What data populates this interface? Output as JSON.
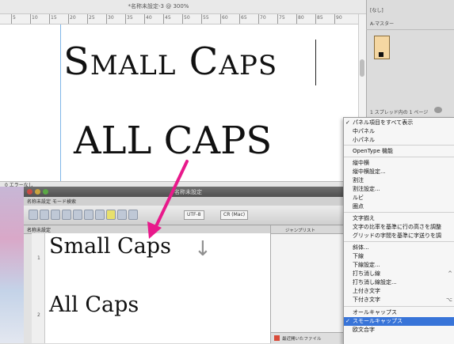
{
  "top_window": {
    "title": "*名称未設定-3 @ 300%",
    "ruler_numbers": [
      "5",
      "10",
      "15",
      "20",
      "25",
      "30",
      "35",
      "40",
      "45",
      "50",
      "55",
      "60",
      "65",
      "70",
      "75",
      "80",
      "85",
      "90"
    ],
    "small_caps_text": "Small Caps",
    "all_caps_text": "ALL CAPS",
    "status_text": "0 エラーなし"
  },
  "right_panel": {
    "title": "[なし]",
    "subtitle": "A-マスター",
    "status": "1 スプレッド内の 1 ページ"
  },
  "editor": {
    "title": "名称未設定",
    "menus": [
      "名称未設定",
      "モード",
      "検索"
    ],
    "toolbar_encoding": "UTF-8",
    "toolbar_lineend": "CR (Mac)",
    "tab_label": "名称未設定",
    "line_numbers": [
      "1",
      "2"
    ],
    "line1": "Small Caps",
    "down_arrow": "↓",
    "line2": "All Caps",
    "side_header": "ジャンプリスト",
    "recent_files": "最近開いたファイル"
  },
  "context_menu": {
    "items": [
      {
        "label": "パネル項目をすべて表示",
        "checked": true,
        "shortcut": ""
      },
      {
        "label": "中パネル",
        "checked": false,
        "shortcut": ""
      },
      {
        "label": "小パネル",
        "checked": false,
        "shortcut": ""
      },
      {
        "label": "OpenType 機能",
        "checked": false,
        "shortcut": ""
      },
      {
        "label": "縦中横",
        "checked": false,
        "shortcut": ""
      },
      {
        "label": "縦中横設定...",
        "checked": false,
        "shortcut": ""
      },
      {
        "label": "割注",
        "checked": false,
        "shortcut": ""
      },
      {
        "label": "割注設定...",
        "checked": false,
        "shortcut": ""
      },
      {
        "label": "ルビ",
        "checked": false,
        "shortcut": ""
      },
      {
        "label": "圏点",
        "checked": false,
        "shortcut": ""
      },
      {
        "label": "文字揃え",
        "checked": false,
        "shortcut": ""
      },
      {
        "label": "文字の比率を基準に行の高さを調整",
        "checked": false,
        "shortcut": ""
      },
      {
        "label": "グリッドの字間を基準に字送りを調",
        "checked": false,
        "shortcut": ""
      },
      {
        "label": "斜体...",
        "checked": false,
        "shortcut": ""
      },
      {
        "label": "下線",
        "checked": false,
        "shortcut": ""
      },
      {
        "label": "下線設定...",
        "checked": false,
        "shortcut": ""
      },
      {
        "label": "打ち消し線",
        "checked": false,
        "shortcut": "^"
      },
      {
        "label": "打ち消し線設定...",
        "checked": false,
        "shortcut": ""
      },
      {
        "label": "上付き文字",
        "checked": false,
        "shortcut": ""
      },
      {
        "label": "下付き文字",
        "checked": false,
        "shortcut": "⌥"
      },
      {
        "label": "オールキャップス",
        "checked": false,
        "shortcut": ""
      },
      {
        "label": "スモールキャップス",
        "checked": true,
        "shortcut": ""
      },
      {
        "label": "欧文合字",
        "checked": false,
        "shortcut": ""
      }
    ]
  },
  "colors": {
    "arrow": "#e8198b",
    "menu_highlight": "#3874d8",
    "guide": "#7fb6e8"
  }
}
